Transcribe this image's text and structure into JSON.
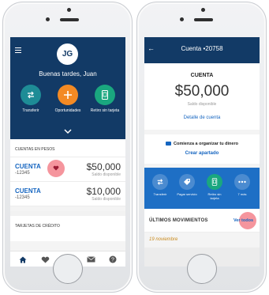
{
  "left": {
    "header": {
      "avatar_initials": "JG",
      "greeting": "Buenas tardes, Juan"
    },
    "actions": [
      {
        "label": "Transferir",
        "icon": "transfer-icon"
      },
      {
        "label": "Oportunidades",
        "icon": "plus-icon"
      },
      {
        "label": "Retiro sin tarjeta",
        "icon": "phone-cash-icon"
      }
    ],
    "accounts_section": {
      "title": "CUENTAS EN PESOS",
      "accounts": [
        {
          "name": "CUENTA",
          "number": "-12345",
          "amount": "$50,000",
          "sub": "Saldo disponible"
        },
        {
          "name": "CUENTA",
          "number": "-12345",
          "amount": "$10,000",
          "sub": "Saldo disponible"
        }
      ]
    },
    "cards_section": {
      "title": "TARJETAS DE CRÉDITO"
    },
    "tabbar": [
      "home-icon",
      "heart-icon",
      "plus-circle-icon",
      "mail-icon",
      "help-icon"
    ]
  },
  "right": {
    "header": {
      "title": "Cuenta •20758"
    },
    "summary": {
      "label": "CUENTA",
      "amount": "$50,000",
      "sub": "Saldo disponible",
      "link": "Detalle de cuenta"
    },
    "promo": {
      "title": "Comienza a organizar tu dinero",
      "link": "Crear apartado"
    },
    "actions": [
      {
        "label": "Transferir",
        "icon": "transfer-icon"
      },
      {
        "label": "Pagar servicio",
        "icon": "tag-icon"
      },
      {
        "label": "Retiro sin tarjeta",
        "icon": "phone-cash-icon"
      },
      {
        "label": "7 más",
        "icon": "more-icon"
      }
    ],
    "movements": {
      "title": "ÚLTIMOS MOVIMIENTOS",
      "link": "Ver todos",
      "date": "19 noviembre"
    }
  },
  "colors": {
    "navy": "#123a66",
    "blue": "#1e6fc5",
    "orange": "#f38a24",
    "green": "#1aa77f",
    "teal": "#1e8c96",
    "tap": "#f05c68",
    "link": "#1565c0"
  }
}
